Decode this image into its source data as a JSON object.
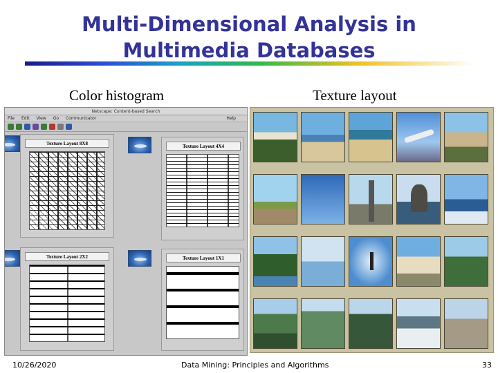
{
  "slide": {
    "title_line1": "Multi-Dimensional Analysis in",
    "title_line2": "Multimedia Databases",
    "caption_left": "Color histogram",
    "caption_right": "Texture layout"
  },
  "browser": {
    "window_title": "Netscape: Content-based Search",
    "menu": [
      "File",
      "Edit",
      "View",
      "Go",
      "Communicator"
    ],
    "menu_help": "Help",
    "cards": [
      {
        "label": "Texture Layout 8X8"
      },
      {
        "label": "Texture Layout 4X4"
      },
      {
        "label": "Texture Layout 2X2"
      },
      {
        "label": "Texture Layout 1X1"
      }
    ]
  },
  "thumbnails": [
    "beach",
    "beach",
    "beach",
    "airplane",
    "town",
    "palm-tree",
    "jets",
    "tower",
    "rocks",
    "waves",
    "trees",
    "lake",
    "sky",
    "pavilion",
    "cable-car",
    "mountain",
    "mountain",
    "forest",
    "glacier",
    "city"
  ],
  "footer": {
    "date": "10/26/2020",
    "center": "Data Mining: Principles and Algorithms",
    "page": "33"
  },
  "colors": {
    "title": "#333399",
    "panel_bg": "#c9c3a3",
    "browser_bg": "#c6c6c6"
  }
}
